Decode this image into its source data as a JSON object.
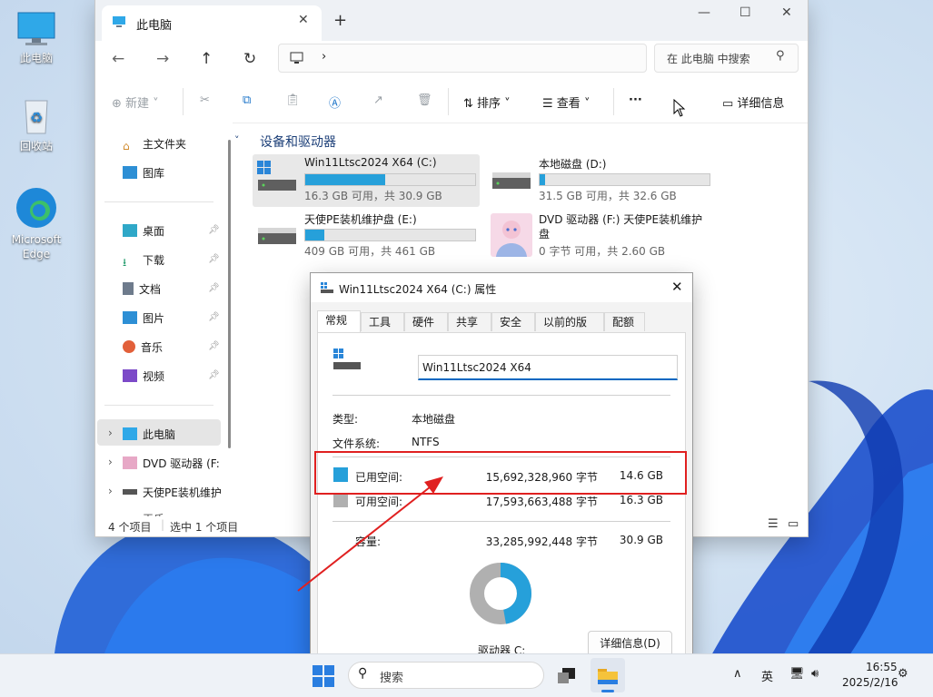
{
  "desktop": {
    "icons": [
      {
        "label": "此电脑"
      },
      {
        "label": "回收站"
      },
      {
        "label": "Microsoft Edge"
      }
    ]
  },
  "explorer": {
    "tab_title": "此电脑",
    "search_placeholder": "在 此电脑 中搜索",
    "toolbar": {
      "new_label": "新建",
      "sort_label": "排序",
      "view_label": "查看",
      "more_label": "···",
      "details_label": "详细信息"
    },
    "nav": {
      "home": "主文件夹",
      "gallery": "图库",
      "desktop": "桌面",
      "downloads": "下载",
      "documents": "文档",
      "pictures": "图片",
      "music": "音乐",
      "videos": "视频",
      "thispc": "此电脑",
      "dvd": "DVD 驱动器 (F:",
      "pe": "天使PE装机维护",
      "partial": "王氏"
    },
    "group_title": "设备和驱动器",
    "drives": [
      {
        "name": "Win11Ltsc2024 X64 (C:)",
        "free": "16.3 GB 可用，共 30.9 GB",
        "used_fraction": 0.47
      },
      {
        "name": "本地磁盘 (D:)",
        "free": "31.5 GB 可用，共 32.6 GB",
        "used_fraction": 0.03
      },
      {
        "name": "天使PE装机维护盘 (E:)",
        "free": "409 GB 可用，共 461 GB",
        "used_fraction": 0.11
      },
      {
        "name_line1": "DVD 驱动器 (F:) 天使PE装机维护",
        "name_line2": "盘",
        "free": "0 字节 可用，共 2.60 GB"
      }
    ],
    "status": {
      "items": "4 个项目",
      "selected": "选中 1 个项目"
    }
  },
  "properties": {
    "title": "Win11Ltsc2024 X64 (C:) 属性",
    "tabs": [
      "常规",
      "工具",
      "硬件",
      "共享",
      "安全",
      "以前的版本",
      "配额"
    ],
    "name_value": "Win11Ltsc2024 X64",
    "type_label": "类型:",
    "type_value": "本地磁盘",
    "fs_label": "文件系统:",
    "fs_value": "NTFS",
    "used_label": "已用空间:",
    "used_bytes": "15,692,328,960 字节",
    "used_size": "14.6 GB",
    "free_label": "可用空间:",
    "free_bytes": "17,593,663,488 字节",
    "free_size": "16.3 GB",
    "capacity_label": "容量:",
    "capacity_bytes": "33,285,992,448 字节",
    "capacity_size": "30.9 GB",
    "drive_label": "驱动器 C:",
    "details_button": "详细信息(D)",
    "used_fraction": 0.471,
    "colors": {
      "used": "#26a0da",
      "free": "#b0b0b0",
      "annotation": "#e02020"
    }
  },
  "taskbar": {
    "search_label": "搜索",
    "ime": "英",
    "time": "16:55",
    "date": "2025/2/16"
  }
}
